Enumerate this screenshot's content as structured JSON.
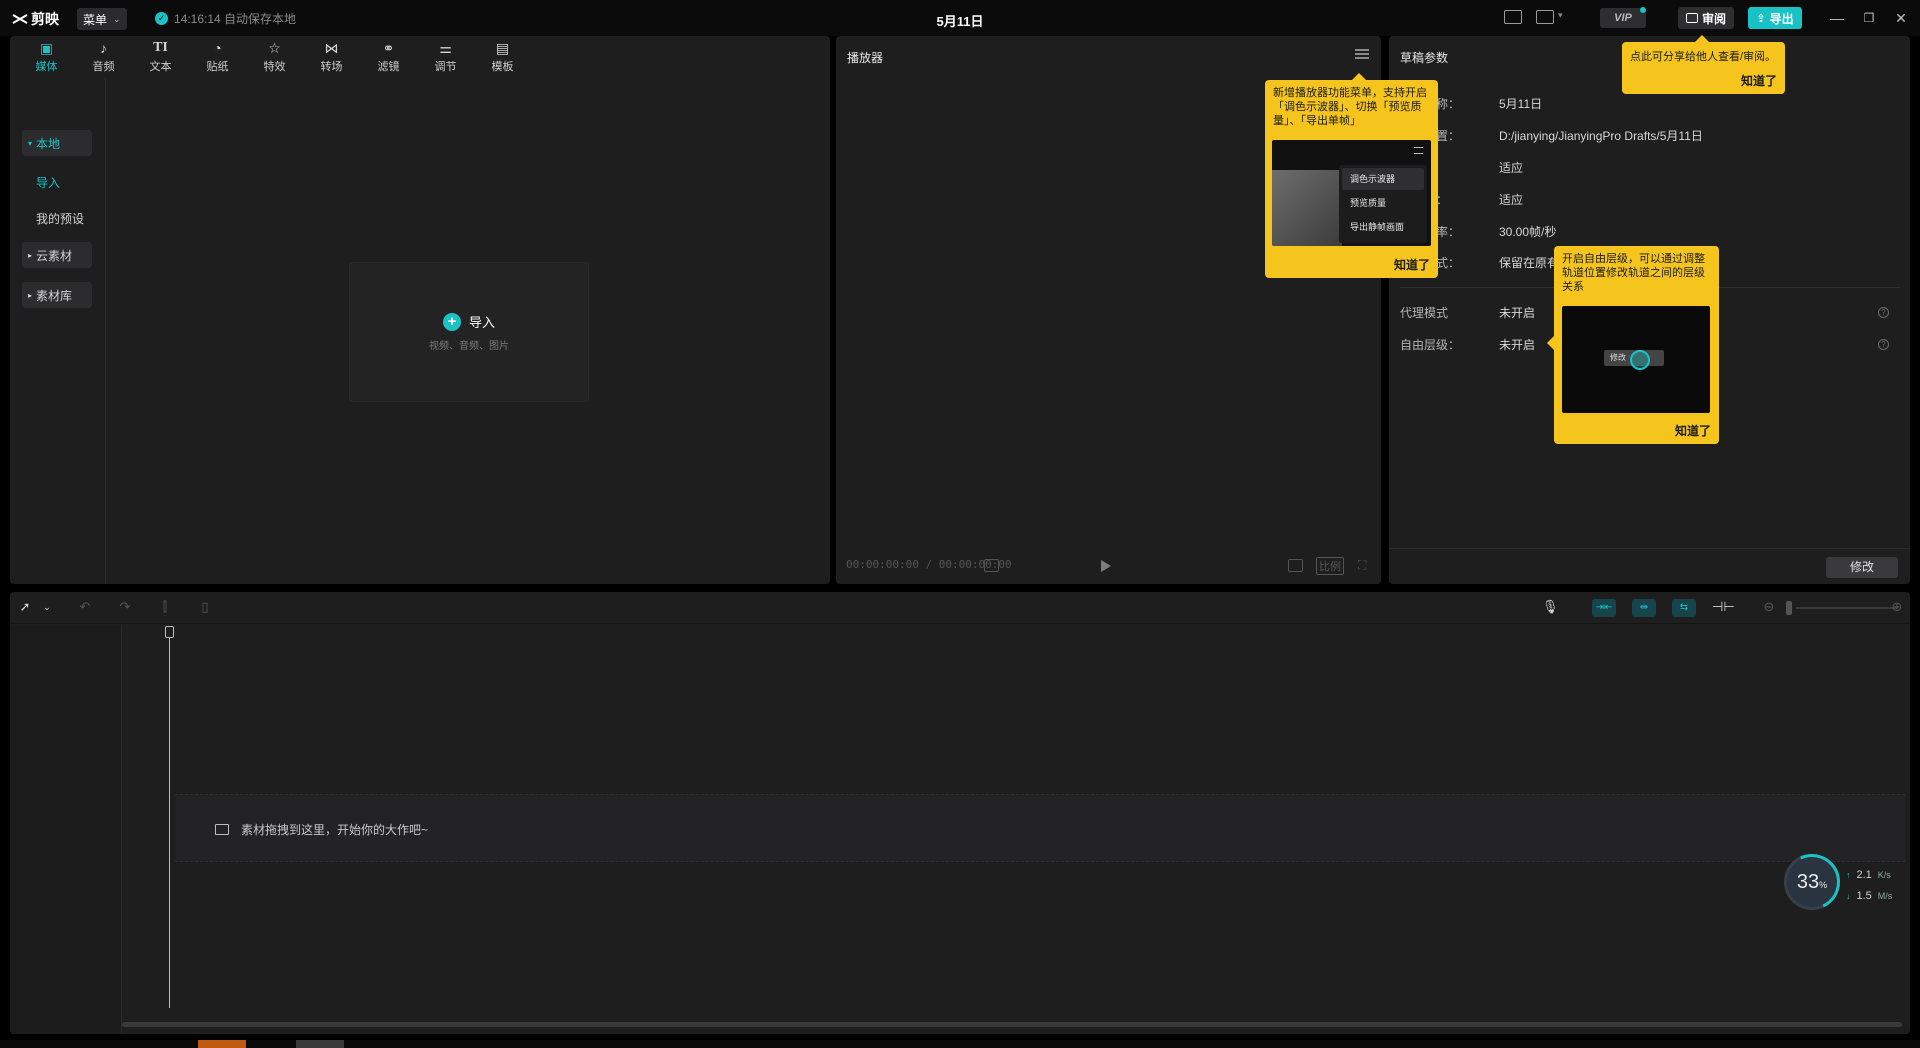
{
  "app": {
    "name": "剪映",
    "menu_label": "菜单",
    "autosave": "14:16:14 自动保存本地",
    "doc_title": "5月11日",
    "vip_label": "VIP",
    "review_label": "审阅",
    "export_label": "导出"
  },
  "media_tabs": [
    {
      "label": "媒体",
      "icon": "media-icon"
    },
    {
      "label": "音频",
      "icon": "audio-icon"
    },
    {
      "label": "文本",
      "icon": "text-icon"
    },
    {
      "label": "贴纸",
      "icon": "sticker-icon"
    },
    {
      "label": "特效",
      "icon": "effects-icon"
    },
    {
      "label": "转场",
      "icon": "transition-icon"
    },
    {
      "label": "滤镜",
      "icon": "filter-icon"
    },
    {
      "label": "调节",
      "icon": "adjust-icon"
    },
    {
      "label": "模板",
      "icon": "template-icon"
    }
  ],
  "media_sidebar": {
    "local": "本地",
    "import": "导入",
    "presets": "我的预设",
    "cloud": "云素材",
    "library": "素材库"
  },
  "import_box": {
    "label": "导入",
    "hint": "视频、音频、图片"
  },
  "player": {
    "title": "播放器",
    "timecode": "00:00:00:00 / 00:00:00:00",
    "ratio_label": "比例"
  },
  "params": {
    "title": "草稿参数",
    "rows": [
      {
        "key": "草稿名称：",
        "value": "5月11日"
      },
      {
        "key": "保存位置：",
        "value": "D:/jianying/JianyingPro Drafts/5月11日"
      },
      {
        "key": "比例：",
        "value": "适应"
      },
      {
        "key": "分辨率：",
        "value": "适应"
      },
      {
        "key": "草稿帧率：",
        "value": "30.00帧/秒"
      },
      {
        "key": "导入方式：",
        "value": "保留在原有位置"
      }
    ],
    "proxy_key": "代理模式",
    "proxy_value": "未开启",
    "layer_key": "自由层级：",
    "layer_value": "未开启",
    "edit_label": "修改"
  },
  "tips": {
    "share": {
      "text": "点此可分享给他人查看/审阅。",
      "ok": "知道了"
    },
    "player_menu": {
      "text": "新增播放器功能菜单，支持开启「调色示波器」、切换「预览质量」、「导出单帧」",
      "menu": [
        "调色示波器",
        "预览质量",
        "导出静帧画面"
      ],
      "ok": "知道了"
    },
    "free_layer": {
      "text": "开启自由层级，可以通过调整轨道位置修改轨道之间的层级关系",
      "button": "修改",
      "ok": "知道了"
    }
  },
  "timeline": {
    "drop_hint": "素材拖拽到这里，开始你的大作吧~"
  },
  "net_monitor": {
    "percent": "33",
    "percent_unit": "%",
    "up": "2.1",
    "up_unit": "K/s",
    "down": "1.5",
    "down_unit": "M/s"
  },
  "colors": {
    "accent": "#19c2c4",
    "tooltip": "#f5c51e",
    "panel": "#1e1e1f"
  }
}
